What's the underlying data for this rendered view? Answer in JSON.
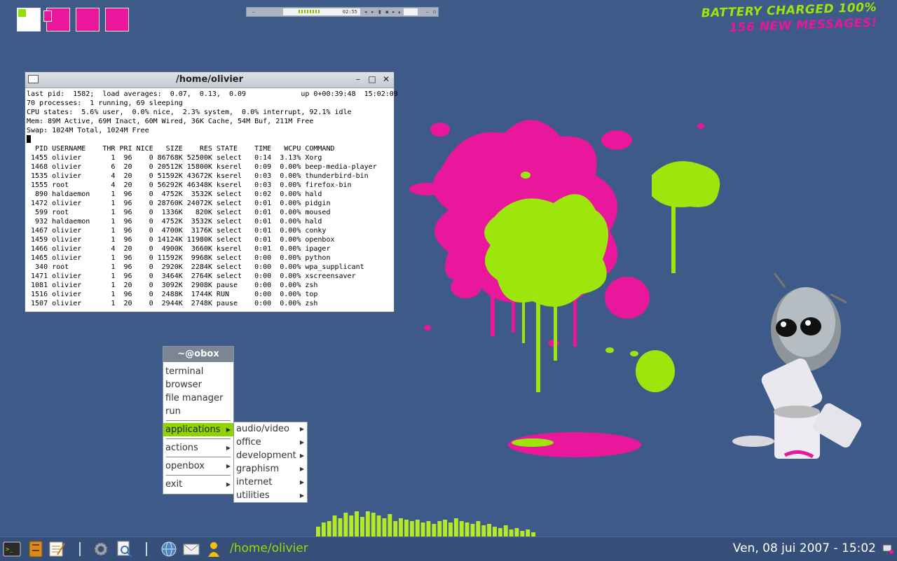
{
  "colors": {
    "desktop": "#3d5a88",
    "lime": "#8fe000",
    "magenta": "#e8179b",
    "menu_title": "#7b8594",
    "menu_selected": "#8fd400"
  },
  "top_widget": {
    "time": "02:55"
  },
  "notifications": {
    "line1": "BATTERY CHARGED 100%",
    "line2": "156 NEW MESSAGES!"
  },
  "terminal": {
    "title": "/home/olivier",
    "summary": [
      "last pid:  1582;  load averages:  0.07,  0.13,  0.09             up 0+00:39:48  15:02:09",
      "70 processes:  1 running, 69 sleeping",
      "CPU states:  5.6% user,  0.0% nice,  2.3% system,  0.0% interrupt, 92.1% idle",
      "Mem: 89M Active, 69M Inact, 60M Wired, 36K Cache, 54M Buf, 211M Free",
      "Swap: 1024M Total, 1024M Free"
    ],
    "header": "  PID USERNAME    THR PRI NICE   SIZE    RES STATE    TIME   WCPU COMMAND",
    "rows": [
      " 1455 olivier       1  96    0 86768K 52500K select   0:14  3.13% Xorg",
      " 1468 olivier       6  20    0 20512K 15800K kserel   0:09  0.00% beep-media-player",
      " 1535 olivier       4  20    0 51592K 43672K kserel   0:03  0.00% thunderbird-bin",
      " 1555 root          4  20    0 56292K 46348K kserel   0:03  0.00% firefox-bin",
      "  890 haldaemon     1  96    0  4752K  3532K select   0:02  0.00% hald",
      " 1472 olivier       1  96    0 28760K 24072K select   0:01  0.00% pidgin",
      "  599 root          1  96    0  1336K   820K select   0:01  0.00% moused",
      "  932 haldaemon     1  96    0  4752K  3532K select   0:01  0.00% hald",
      " 1467 olivier       1  96    0  4700K  3176K select   0:01  0.00% conky",
      " 1459 olivier       1  96    0 14124K 11980K select   0:01  0.00% openbox",
      " 1466 olivier       4  20    0  4900K  3660K kserel   0:01  0.00% ipager",
      " 1465 olivier       1  96    0 11592K  9968K select   0:00  0.00% python",
      "  340 root          1  96    0  2920K  2284K select   0:00  0.00% wpa_supplicant",
      " 1471 olivier       1  96    0  3464K  2764K select   0:00  0.00% xscreensaver",
      " 1081 olivier       1  20    0  3092K  2908K pause    0:00  0.00% zsh",
      " 1516 olivier       1  96    0  2488K  1744K RUN      0:00  0.00% top",
      " 1507 olivier       1  20    0  2944K  2748K pause    0:00  0.00% zsh"
    ]
  },
  "root_menu": {
    "title": "~@obox",
    "terminal": "terminal",
    "browser": "browser",
    "file_manager": "file manager",
    "run": "run",
    "applications": "applications",
    "actions": "actions",
    "openbox": "openbox",
    "exit": "exit"
  },
  "apps_menu": {
    "audio_video": "audio/video",
    "office": "office",
    "development": "development",
    "graphism": "graphism",
    "internet": "internet",
    "utilities": "utilities"
  },
  "equalizer": [
    14,
    20,
    22,
    30,
    26,
    34,
    30,
    38,
    28,
    36,
    34,
    30,
    26,
    32,
    22,
    26,
    24,
    22,
    24,
    20,
    22,
    18,
    22,
    24,
    20,
    26,
    22,
    20,
    18,
    22,
    16,
    18,
    14,
    12,
    16,
    10,
    12,
    8,
    10,
    6
  ],
  "taskbar": {
    "path": "/home/olivier",
    "clock": "Ven, 08 jui 2007 - 15:02"
  }
}
